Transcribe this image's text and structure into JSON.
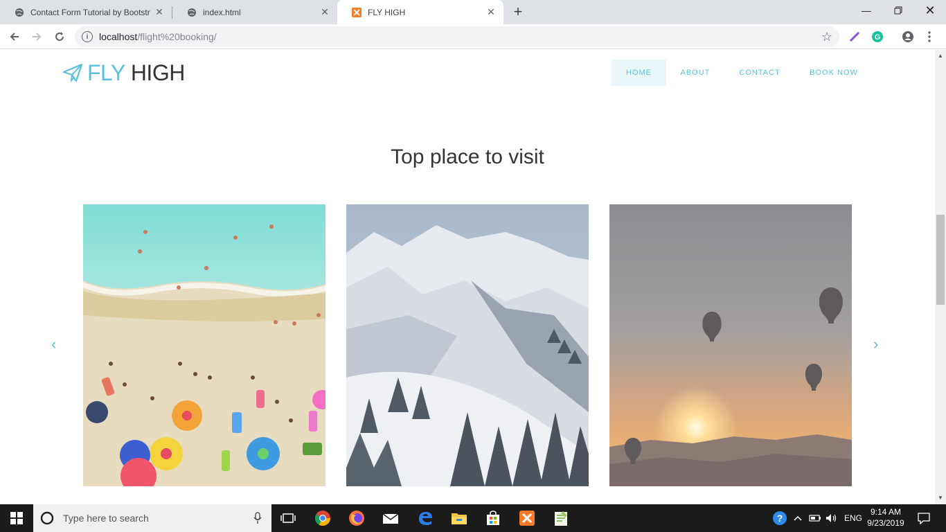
{
  "browser": {
    "tabs": [
      {
        "title": "Contact Form Tutorial by Bootstr"
      },
      {
        "title": "index.html"
      },
      {
        "title": "FLY HIGH"
      }
    ],
    "url_host": "localhost",
    "url_path": "/flight%20booking/"
  },
  "site": {
    "brand_fly": "FLY",
    "brand_high": "HIGH",
    "nav": [
      {
        "label": "HOME"
      },
      {
        "label": "ABOUT"
      },
      {
        "label": "CONTACT"
      },
      {
        "label": "BOOK NOW"
      }
    ],
    "section_title": "Top place to visit",
    "prev_glyph": "‹",
    "next_glyph": "›",
    "accent_color": "#5bc0de"
  },
  "taskbar": {
    "search_placeholder": "Type here to search",
    "language": "ENG",
    "time": "9:14 AM",
    "date": "9/23/2019"
  }
}
